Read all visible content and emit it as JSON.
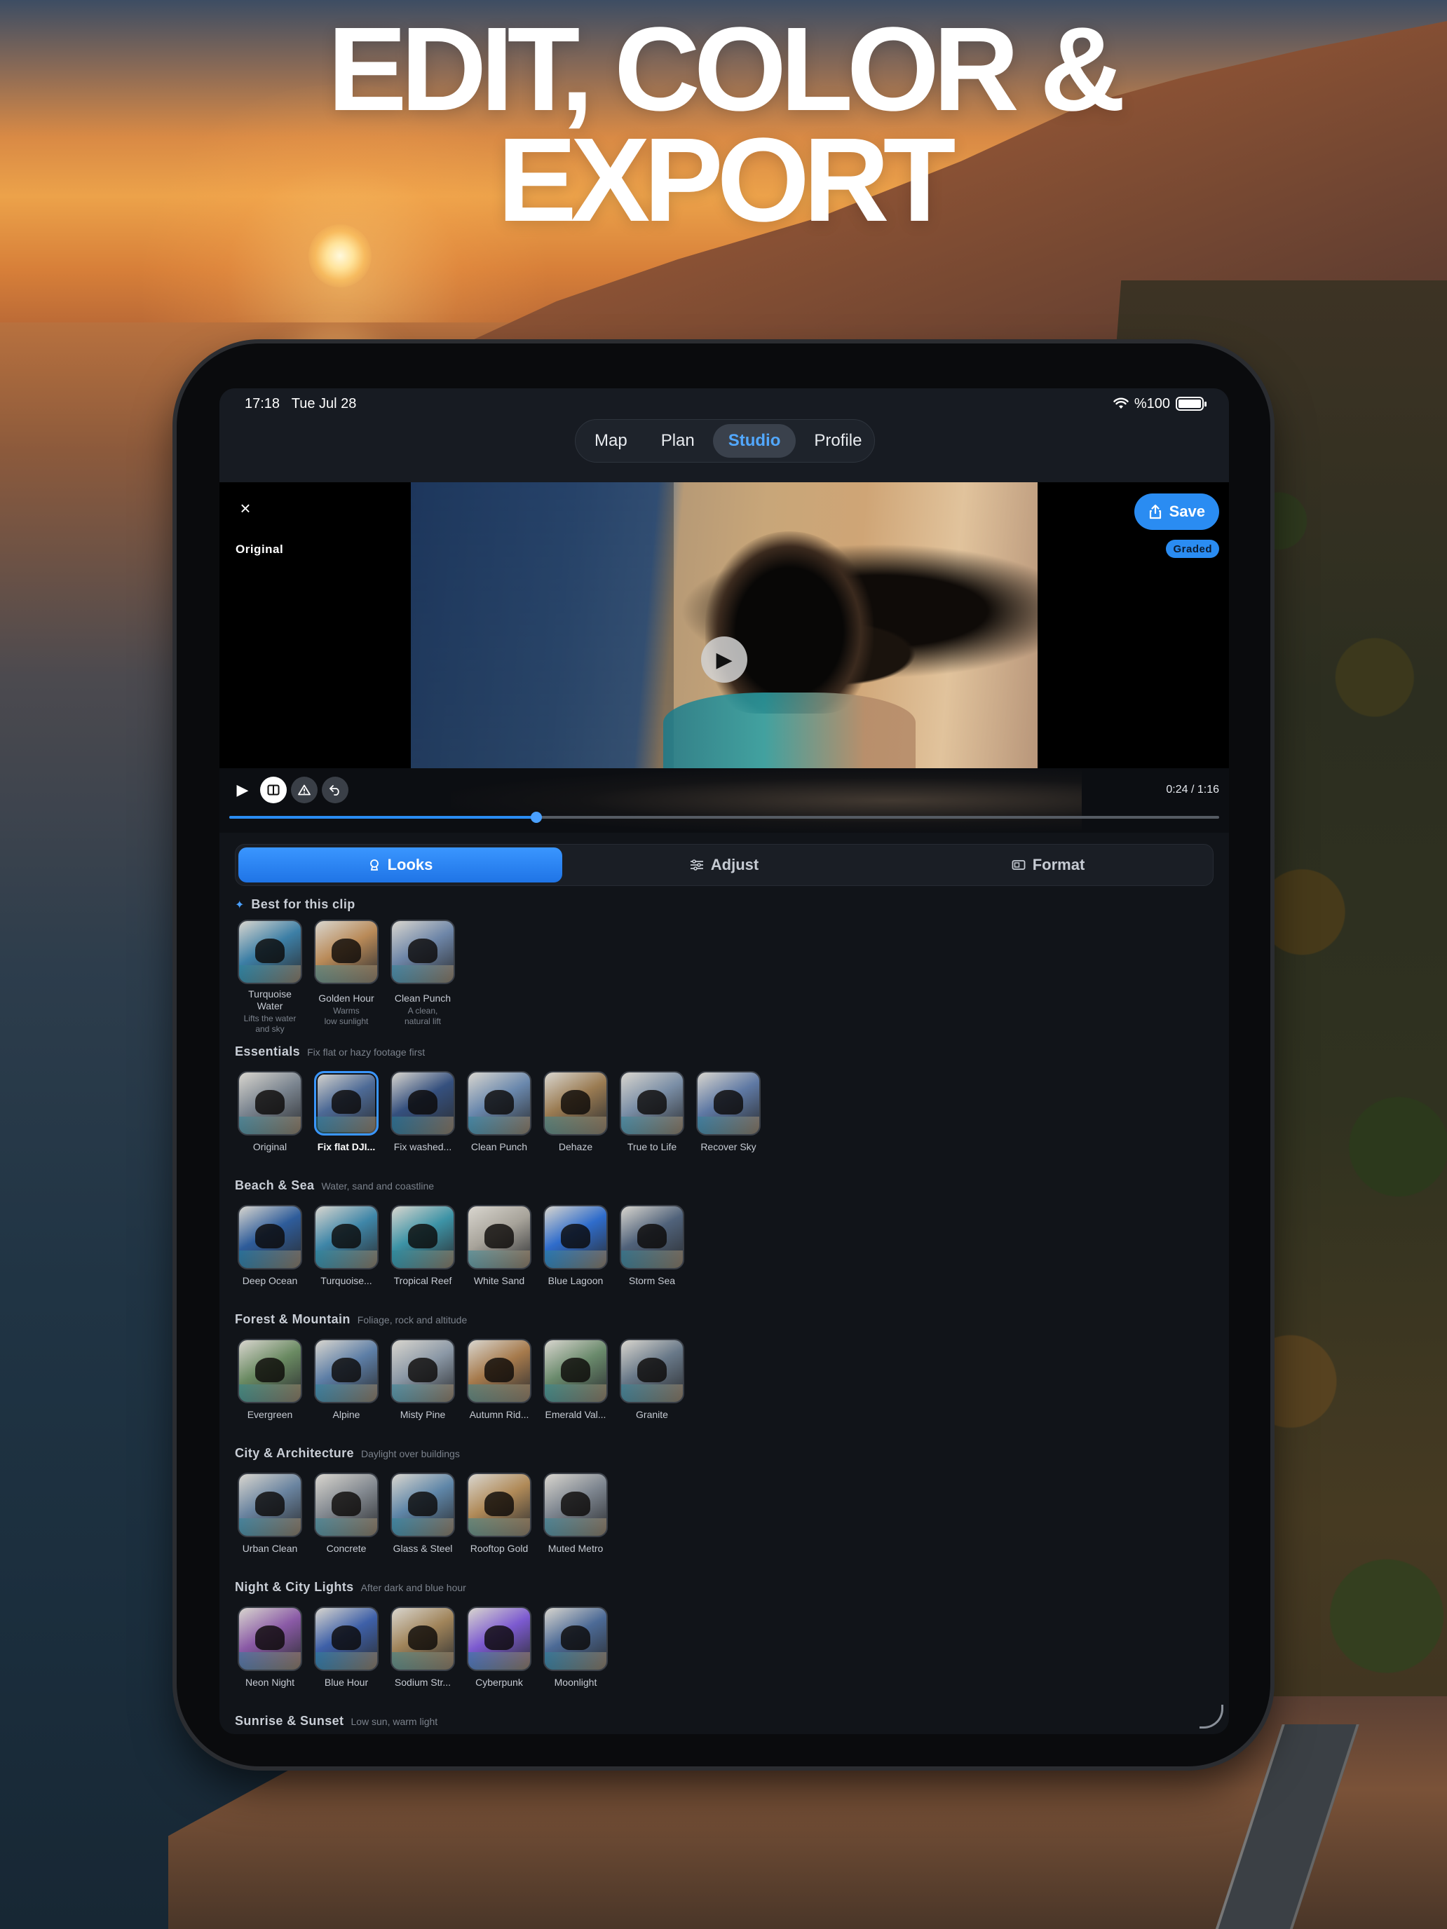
{
  "headline": {
    "line1": "EDIT, COLOR &",
    "line2": "EXPORT"
  },
  "status": {
    "time": "17:18",
    "date": "Tue Jul 28",
    "battery": "%100"
  },
  "nav": {
    "items": [
      {
        "label": "Map",
        "active": false
      },
      {
        "label": "Plan",
        "active": false
      },
      {
        "label": "Studio",
        "active": true
      },
      {
        "label": "Profile",
        "active": false
      }
    ]
  },
  "preview": {
    "close": "×",
    "original_label": "Original",
    "save_label": "Save",
    "graded_label": "Graded"
  },
  "transport": {
    "timecode": "0:24 / 1:16",
    "progress": 0.31
  },
  "tabs": [
    {
      "label": "Looks",
      "icon": "palette-icon",
      "active": true
    },
    {
      "label": "Adjust",
      "icon": "sliders-icon",
      "active": false
    },
    {
      "label": "Format",
      "icon": "aspect-ratio-icon",
      "active": false
    }
  ],
  "best": {
    "title": "Best for this clip",
    "items": [
      {
        "label": "Turquoise Water",
        "label_lines": [
          "Turquoise",
          "Water"
        ],
        "desc_lines": [
          "Lifts the water",
          "and sky"
        ],
        "tint": "#3d7fa6"
      },
      {
        "label": "Golden Hour",
        "label_lines": [
          "Golden Hour"
        ],
        "desc_lines": [
          "Warms",
          "low sunlight"
        ],
        "tint": "#b98a58"
      },
      {
        "label": "Clean Punch",
        "label_lines": [
          "Clean Punch"
        ],
        "desc_lines": [
          "A clean,",
          "natural lift"
        ],
        "tint": "#6e86a8"
      }
    ]
  },
  "sections": [
    {
      "title": "Essentials",
      "subtitle": "Fix flat or hazy footage first",
      "items": [
        {
          "label": "Original",
          "tint": "#7b8590"
        },
        {
          "label": "Fix flat DJI...",
          "tint": "#4d6a96",
          "selected": true
        },
        {
          "label": "Fix washed...",
          "tint": "#35507e"
        },
        {
          "label": "Clean Punch",
          "tint": "#6a88ad"
        },
        {
          "label": "Dehaze",
          "tint": "#9a7b52"
        },
        {
          "label": "True to Life",
          "tint": "#7a8ea6"
        },
        {
          "label": "Recover Sky",
          "tint": "#5f79a4"
        }
      ]
    },
    {
      "title": "Beach & Sea",
      "subtitle": "Water, sand and coastline",
      "items": [
        {
          "label": "Deep Ocean",
          "tint": "#2e5c9a"
        },
        {
          "label": "Turquoise...",
          "tint": "#3f86a8"
        },
        {
          "label": "Tropical Reef",
          "tint": "#3d93a6"
        },
        {
          "label": "White Sand",
          "tint": "#a7a39a"
        },
        {
          "label": "Blue Lagoon",
          "tint": "#2f6ccb"
        },
        {
          "label": "Storm Sea",
          "tint": "#50627a"
        }
      ]
    },
    {
      "title": "Forest & Mountain",
      "subtitle": "Foliage, rock and altitude",
      "items": [
        {
          "label": "Evergreen",
          "tint": "#6a8a62"
        },
        {
          "label": "Alpine",
          "tint": "#5d7ea6"
        },
        {
          "label": "Misty Pine",
          "tint": "#8b98a6"
        },
        {
          "label": "Autumn Rid...",
          "tint": "#a67a4c"
        },
        {
          "label": "Emerald Val...",
          "tint": "#6a8a6c"
        },
        {
          "label": "Granite",
          "tint": "#687888"
        }
      ]
    },
    {
      "title": "City & Architecture",
      "subtitle": "Daylight over buildings",
      "items": [
        {
          "label": "Urban Clean",
          "tint": "#6a84a0"
        },
        {
          "label": "Concrete",
          "tint": "#858b92"
        },
        {
          "label": "Glass & Steel",
          "tint": "#5f86a8"
        },
        {
          "label": "Rooftop Gold",
          "tint": "#b08a58"
        },
        {
          "label": "Muted Metro",
          "tint": "#7e8690"
        }
      ]
    },
    {
      "title": "Night & City Lights",
      "subtitle": "After dark and blue hour",
      "items": [
        {
          "label": "Neon Night",
          "tint": "#8a5aa6"
        },
        {
          "label": "Blue Hour",
          "tint": "#3e60a8"
        },
        {
          "label": "Sodium Str...",
          "tint": "#a0845a"
        },
        {
          "label": "Cyberpunk",
          "tint": "#7c5ad0"
        },
        {
          "label": "Moonlight",
          "tint": "#4c6a96"
        }
      ]
    },
    {
      "title": "Sunrise & Sunset",
      "subtitle": "Low sun, warm light",
      "items": []
    }
  ],
  "colors": {
    "accent": "#2a8cf2",
    "screen_bg": "#111419"
  }
}
